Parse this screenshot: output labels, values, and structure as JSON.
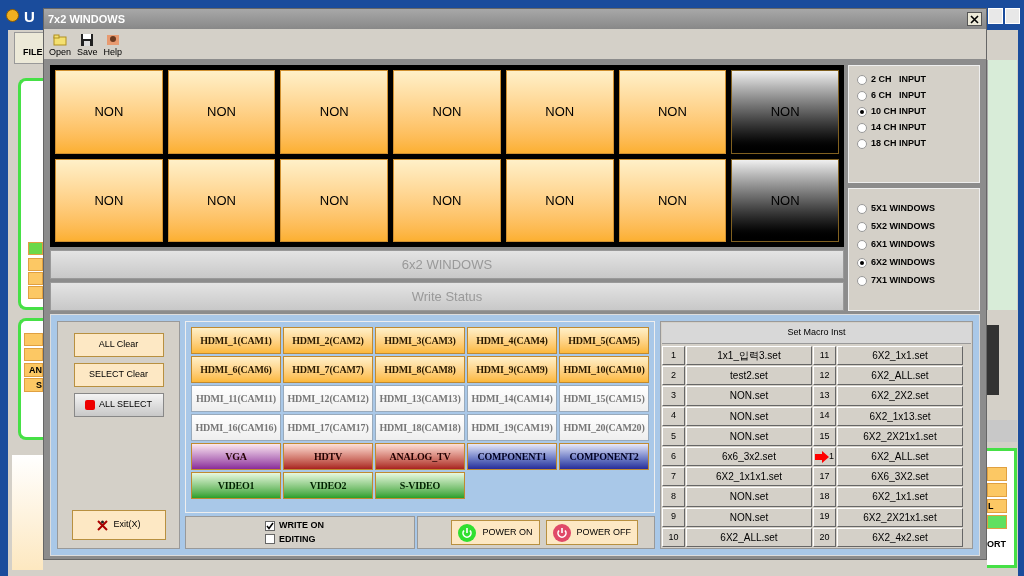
{
  "app": {
    "title": "U",
    "menu_label": "FILE",
    "left_labels": [
      "AN",
      "S"
    ],
    "right_labels": [
      "L",
      "ORT"
    ]
  },
  "dialog": {
    "title": "7x2 WINDOWS",
    "toolbar": [
      {
        "label": "Open",
        "kind": "folder"
      },
      {
        "label": "Save",
        "kind": "disk"
      },
      {
        "label": "Help",
        "kind": "help"
      }
    ],
    "tiles": [
      {
        "label": "NON",
        "active": true
      },
      {
        "label": "NON",
        "active": true
      },
      {
        "label": "NON",
        "active": true
      },
      {
        "label": "NON",
        "active": true
      },
      {
        "label": "NON",
        "active": true
      },
      {
        "label": "NON",
        "active": true
      },
      {
        "label": "NON",
        "active": false
      },
      {
        "label": "NON",
        "active": true
      },
      {
        "label": "NON",
        "active": true
      },
      {
        "label": "NON",
        "active": true
      },
      {
        "label": "NON",
        "active": true
      },
      {
        "label": "NON",
        "active": true
      },
      {
        "label": "NON",
        "active": true
      },
      {
        "label": "NON",
        "active": false
      }
    ],
    "layout_bar": "6x2 WINDOWS",
    "status_bar": "Write Status",
    "inputs": [
      {
        "label": "2 CH   INPUT",
        "selected": false
      },
      {
        "label": "6 CH   INPUT",
        "selected": false
      },
      {
        "label": "10 CH INPUT",
        "selected": true
      },
      {
        "label": "14 CH INPUT",
        "selected": false
      },
      {
        "label": "18 CH INPUT",
        "selected": false
      }
    ],
    "layouts": [
      {
        "label": "5X1 WINDOWS",
        "selected": false
      },
      {
        "label": "5X2 WINDOWS",
        "selected": false
      },
      {
        "label": "6X1 WINDOWS",
        "selected": false
      },
      {
        "label": "6X2 WINDOWS",
        "selected": true
      },
      {
        "label": "7X1 WINDOWS",
        "selected": false
      }
    ],
    "controls": [
      {
        "label": "ALL Clear",
        "kind": "plain"
      },
      {
        "label": "SELECT Clear",
        "kind": "plain"
      },
      {
        "label": "ALL SELECT",
        "kind": "marked"
      }
    ],
    "exit_button": "Exit(X)",
    "sources": [
      {
        "label": "HDMI_1(CAM1)",
        "kind": "on"
      },
      {
        "label": "HDMI_2(CAM2)",
        "kind": "on"
      },
      {
        "label": "HDMI_3(CAM3)",
        "kind": "on"
      },
      {
        "label": "HDMI_4(CAM4)",
        "kind": "on"
      },
      {
        "label": "HDMI_5(CAM5)",
        "kind": "on"
      },
      {
        "label": "HDMI_6(CAM6)",
        "kind": "on"
      },
      {
        "label": "HDMI_7(CAM7)",
        "kind": "on"
      },
      {
        "label": "HDMI_8(CAM8)",
        "kind": "on"
      },
      {
        "label": "HDMI_9(CAM9)",
        "kind": "on"
      },
      {
        "label": "HDMI_10(CAM10)",
        "kind": "on"
      },
      {
        "label": "HDMI_11(CAM11)",
        "kind": "off"
      },
      {
        "label": "HDMI_12(CAM12)",
        "kind": "off"
      },
      {
        "label": "HDMI_13(CAM13)",
        "kind": "off"
      },
      {
        "label": "HDMI_14(CAM14)",
        "kind": "off"
      },
      {
        "label": "HDMI_15(CAM15)",
        "kind": "off"
      },
      {
        "label": "HDMI_16(CAM16)",
        "kind": "off"
      },
      {
        "label": "HDMI_17(CAM17)",
        "kind": "off"
      },
      {
        "label": "HDMI_18(CAM18)",
        "kind": "off"
      },
      {
        "label": "HDMI_19(CAM19)",
        "kind": "off"
      },
      {
        "label": "HDMI_20(CAM20)",
        "kind": "off"
      },
      {
        "label": "VGA",
        "kind": "vga"
      },
      {
        "label": "HDTV",
        "kind": "hdtv"
      },
      {
        "label": "ANALOG_TV",
        "kind": "hdtv"
      },
      {
        "label": "COMPONENT1",
        "kind": "component"
      },
      {
        "label": "COMPONENT2",
        "kind": "component"
      },
      {
        "label": "VIDEO1",
        "kind": "video"
      },
      {
        "label": "VIDEO2",
        "kind": "video"
      },
      {
        "label": "S-VIDEO",
        "kind": "video"
      }
    ],
    "checks": [
      {
        "label": "WRITE ON",
        "checked": true
      },
      {
        "label": "EDITING",
        "checked": false
      }
    ],
    "power": [
      {
        "label": "POWER ON",
        "kind": "on"
      },
      {
        "label": "POWER OFF",
        "kind": "off"
      }
    ],
    "macro": {
      "title": "Set Macro Inst",
      "rows": [
        {
          "number": "1",
          "file": "1x1_입력3.set",
          "current": false
        },
        {
          "number": "2",
          "file": "test2.set",
          "current": false
        },
        {
          "number": "3",
          "file": "NON.set",
          "current": false
        },
        {
          "number": "4",
          "file": "NON.set",
          "current": false
        },
        {
          "number": "5",
          "file": "NON.set",
          "current": false
        },
        {
          "number": "6",
          "file": "6x6_3x2.set",
          "current": false
        },
        {
          "number": "7",
          "file": "6X2_1x1x1.set",
          "current": false
        },
        {
          "number": "8",
          "file": "NON.set",
          "current": false
        },
        {
          "number": "9",
          "file": "NON.set",
          "current": false
        },
        {
          "number": "10",
          "file": "6X2_ALL.set",
          "current": false
        },
        {
          "number": "11",
          "file": "6X2_1x1.set",
          "current": false
        },
        {
          "number": "12",
          "file": "6X2_ALL.set",
          "current": false
        },
        {
          "number": "13",
          "file": "6X2_2X2.set",
          "current": false
        },
        {
          "number": "14",
          "file": "6X2_1x13.set",
          "current": false
        },
        {
          "number": "15",
          "file": "6X2_2X21x1.set",
          "current": false
        },
        {
          "number": "1",
          "file": "6X2_ALL.set",
          "current": true
        },
        {
          "number": "17",
          "file": "6X6_3X2.set",
          "current": false
        },
        {
          "number": "18",
          "file": "6X2_1x1.set",
          "current": false
        },
        {
          "number": "19",
          "file": "6X2_2X21x1.set",
          "current": false
        },
        {
          "number": "20",
          "file": "6X2_4x2.set",
          "current": false
        }
      ]
    }
  }
}
